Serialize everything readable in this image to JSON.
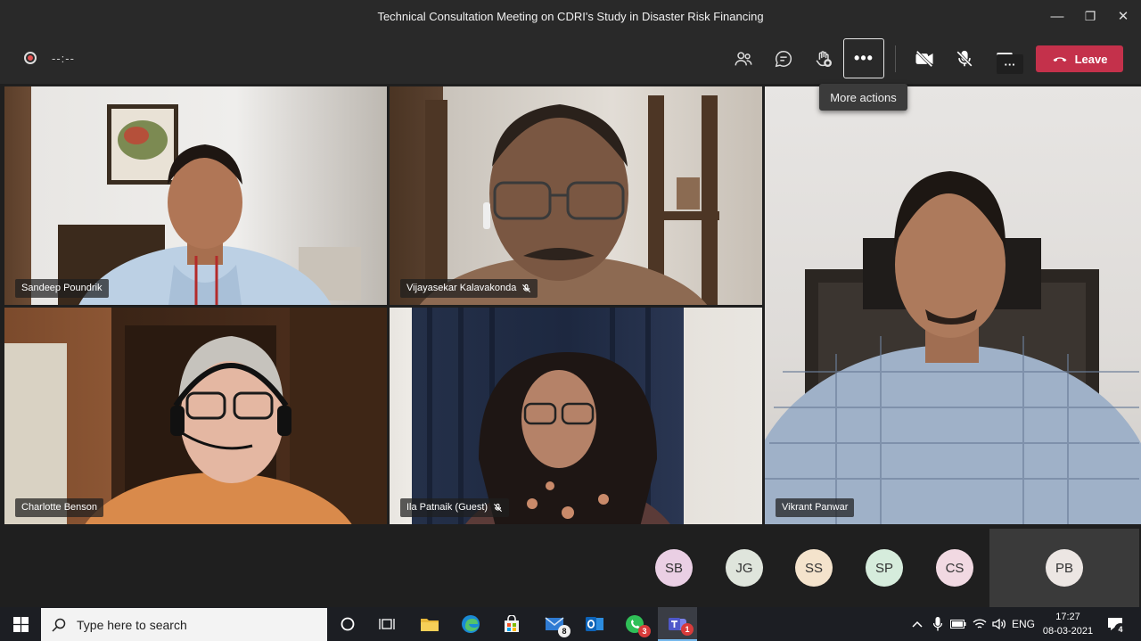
{
  "window": {
    "title": "Technical Consultation Meeting on CDRI's Study in Disaster Risk Financing",
    "minimize": "—",
    "maximize": "❐",
    "close": "✕"
  },
  "toolbar": {
    "timer": "--:--",
    "more_label": "•••",
    "more_tooltip": "More actions",
    "leave_label": "Leave",
    "leave_color": "#c4314b"
  },
  "participants": [
    {
      "name": "Sandeep Poundrik",
      "muted": false
    },
    {
      "name": "Vijayasekar Kalavakonda",
      "muted": true
    },
    {
      "name": "Vikrant Panwar",
      "muted": false
    },
    {
      "name": "Charlotte Benson",
      "muted": false
    },
    {
      "name": "Ila Patnaik (Guest)",
      "muted": true
    }
  ],
  "avatars": [
    {
      "initials": "SB",
      "color": "#eacfe4"
    },
    {
      "initials": "JG",
      "color": "#dfe5dc"
    },
    {
      "initials": "SS",
      "color": "#f4e3cc"
    },
    {
      "initials": "SP",
      "color": "#d6ecdc"
    },
    {
      "initials": "CS",
      "color": "#f1d9e2"
    },
    {
      "initials": "PB",
      "color": "#ece6e3"
    }
  ],
  "strip_more": "···",
  "taskbar": {
    "search_placeholder": "Type here to search",
    "mail_badge": "8",
    "whatsapp_badge": "3",
    "teams_badge": "1",
    "language": "ENG",
    "time": "17:27",
    "date": "08-03-2021",
    "notifications": "4"
  }
}
